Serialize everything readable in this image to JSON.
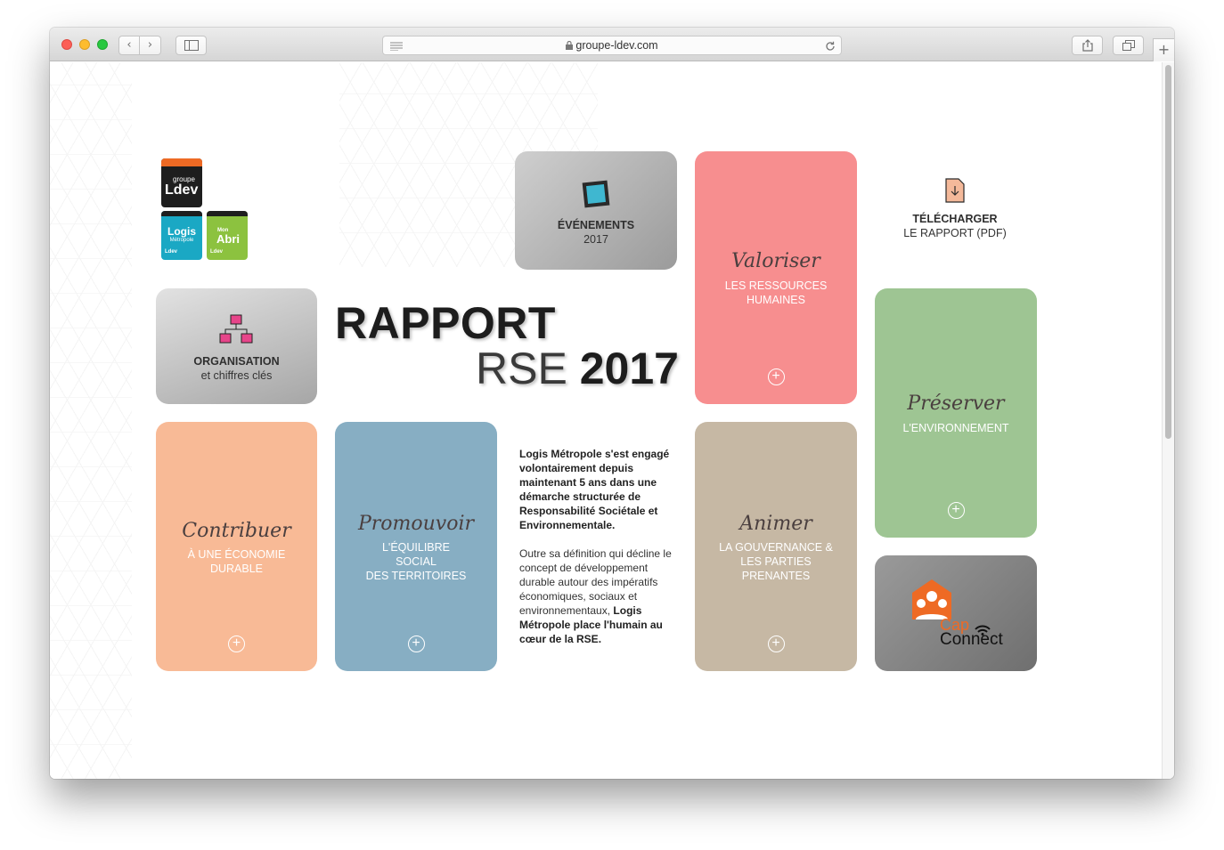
{
  "browser": {
    "url": "groupe-ldev.com",
    "back_glyph": "‹",
    "forward_glyph": "›",
    "new_tab_glyph": "+"
  },
  "logos": {
    "groupe": {
      "small": "groupe",
      "big": "Ldev"
    },
    "logis": {
      "top": "Logis",
      "sub": "Métropole",
      "brand": "Ldev"
    },
    "monabri": {
      "top": "Mon",
      "big": "Abri",
      "brand": "Ldev"
    }
  },
  "evenements": {
    "title": "ÉVÉNEMENTS",
    "year": "2017"
  },
  "organisation": {
    "title": "ORGANISATION",
    "subtitle": "et chiffres clés"
  },
  "headline": {
    "line1": "RAPPORT",
    "line2_light": "RSE",
    "line2_bold": "2017"
  },
  "valoriser": {
    "script": "Valoriser",
    "caps": "LES RESSOURCES HUMAINES"
  },
  "download": {
    "title": "TÉLÉCHARGER",
    "subtitle": "LE RAPPORT (PDF)"
  },
  "preserver": {
    "script": "Préserver",
    "caps": "L'ENVIRONNEMENT"
  },
  "contribuer": {
    "script": "Contribuer",
    "caps": "À UNE ÉCONOMIE DURABLE"
  },
  "promouvoir": {
    "script": "Promouvoir",
    "caps_l1": "L'ÉQUILIBRE",
    "caps_l2": "SOCIAL",
    "caps_l3": "DES TERRITOIRES"
  },
  "animer": {
    "script": "Animer",
    "caps": "LA GOUVERNANCE & LES PARTIES PRENANTES"
  },
  "capconnect": {
    "cap": "Cap",
    "connect": "Connect"
  },
  "paragraph": {
    "p1_bold": "Logis Métropole s'est engagé volontairement depuis maintenant 5 ans dans une démarche structurée de Responsabilité Sociétale et Environnementale.",
    "p2_text": "Outre sa définition qui décline le concept de développement durable autour des impératifs économiques, sociaux et environnementaux,",
    "p2_bold": "Logis Métropole place l'humain au cœur de la RSE."
  },
  "colors": {
    "valoriser": "#f78e8f",
    "preserver": "#9ec593",
    "contribuer": "#f8ba96",
    "promouvoir": "#87aec3",
    "animer": "#c6b8a4",
    "ldev_orange": "#ee6a24",
    "logis_cyan": "#1aa8c4",
    "monabri_green": "#8cc23f"
  },
  "icons": {
    "plus": "+"
  }
}
